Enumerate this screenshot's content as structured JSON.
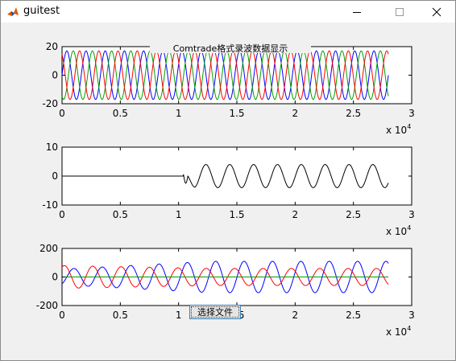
{
  "window": {
    "title": "guitest",
    "icon": "matlab-icon"
  },
  "figure": {
    "title": "Comtrade格式录波数据显示"
  },
  "button": {
    "label": "选择文件"
  },
  "colors": {
    "phase_a": "#0000ff",
    "phase_b": "#00a000",
    "phase_c": "#ff0000",
    "single": "#000000"
  },
  "chart_data": [
    {
      "type": "line",
      "title": "Comtrade格式录波数据显示",
      "x_range": [
        0,
        30000
      ],
      "ylim": [
        -20,
        20
      ],
      "xticks": [
        "0",
        "0.5",
        "1",
        "1.5",
        "2",
        "2.5",
        "3"
      ],
      "yticks": [
        "20",
        "0",
        "-20"
      ],
      "x_multiplier": "x 10^4",
      "series": [
        {
          "color": "#0000ff",
          "amplitude": 17,
          "cycles": 17,
          "phase_deg": 0,
          "x_end": 28000
        },
        {
          "color": "#00a000",
          "amplitude": 17,
          "cycles": 17,
          "phase_deg": -120,
          "x_end": 28000
        },
        {
          "color": "#ff0000",
          "amplitude": 17,
          "cycles": 17,
          "phase_deg": 120,
          "x_end": 28000
        }
      ]
    },
    {
      "type": "line",
      "x_range": [
        0,
        30000
      ],
      "ylim": [
        -10,
        10
      ],
      "xticks": [
        "0",
        "0.5",
        "1",
        "1.5",
        "2",
        "2.5",
        "3"
      ],
      "yticks": [
        "10",
        "0",
        "-10"
      ],
      "x_multiplier": "x 10^4",
      "series": [
        {
          "color": "#000000",
          "zero_until": 10400,
          "amplitude": 4,
          "cycles_after": 8.6,
          "x_end": 28000
        }
      ]
    },
    {
      "type": "line",
      "x_range": [
        0,
        30000
      ],
      "ylim": [
        -200,
        200
      ],
      "xticks": [
        "0",
        "0.5",
        "1",
        "1.5",
        "2",
        "2.5",
        "3"
      ],
      "yticks": [
        "200",
        "0",
        "-200"
      ],
      "x_multiplier": "x 10^4",
      "series": [
        {
          "color": "#0000ff",
          "amplitude_start": 55,
          "amplitude_end": 110,
          "cycles": 11.5,
          "phase_deg": -60,
          "x_end": 28000
        },
        {
          "color": "#ff0000",
          "amplitude_start": 80,
          "amplitude_end": 60,
          "cycles": 11.5,
          "phase_deg": 60,
          "x_end": 28000
        },
        {
          "color": "#00a000",
          "amplitude_start": 0,
          "amplitude_end": 0,
          "cycles": 11.5,
          "phase_deg": 0,
          "x_end": 28000
        }
      ]
    }
  ]
}
